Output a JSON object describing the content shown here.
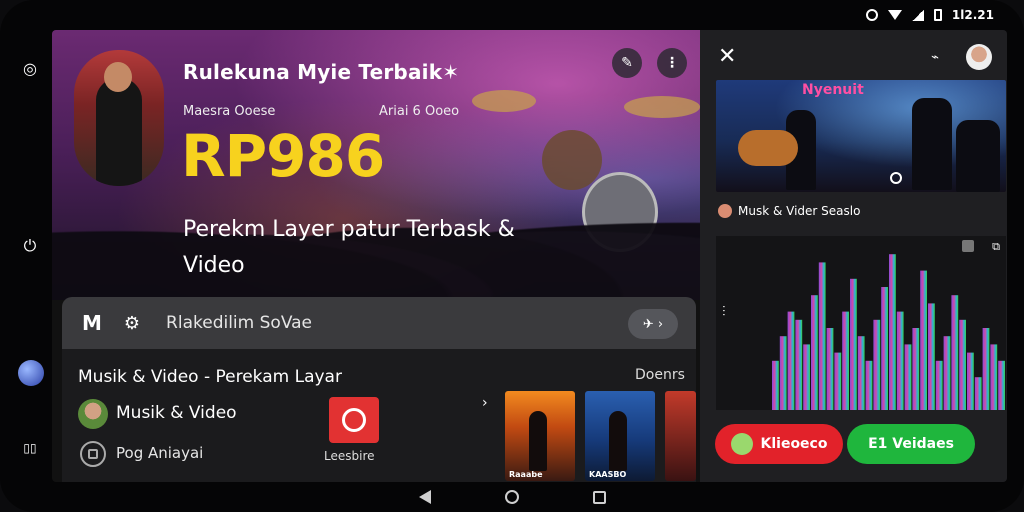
{
  "status_bar": {
    "time": "1l2.21"
  },
  "hero": {
    "title": "Rulekuna Myie Terbaik✶",
    "sub_left": "Maesra Ooese",
    "sub_right": "Ariai 6 Ooeo",
    "price": "RP986",
    "description": "Perekm Layer patur Terbask & Video"
  },
  "search": {
    "logo": "M",
    "text": "Rlakedilim SoVae"
  },
  "lower": {
    "title": "Musik & Video - Perekam Layar",
    "right_label": "Doenrs",
    "row1_label": "Musik & Video",
    "row2_label": "Pog Aniayai",
    "app_label": "Leesbire",
    "thumbs": [
      {
        "caption": "Raaabe"
      },
      {
        "caption": "KAASBO"
      },
      {
        "caption": ""
      }
    ]
  },
  "right_panel": {
    "video_title": "Nyenuit",
    "channel": "Musk & Vider ꓢeaslo",
    "button_left": "Klieoeco",
    "button_right": "E1 Veidaes",
    "wave_levels": [
      0.3,
      0.45,
      0.6,
      0.55,
      0.4,
      0.7,
      0.9,
      0.5,
      0.35,
      0.6,
      0.8,
      0.45,
      0.3,
      0.55,
      0.75,
      0.95,
      0.6,
      0.4,
      0.5,
      0.85,
      0.65,
      0.3,
      0.45,
      0.7,
      0.55,
      0.35,
      0.2,
      0.5,
      0.4,
      0.3
    ]
  }
}
